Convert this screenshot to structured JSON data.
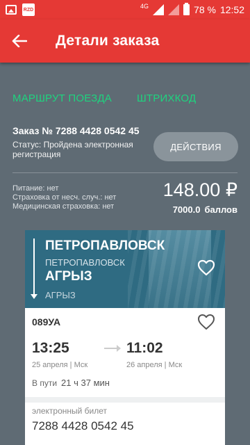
{
  "status_bar": {
    "network": "4G",
    "battery": "78 %",
    "time": "12:52",
    "app_icon_text": "RZD"
  },
  "toolbar": {
    "title": "Детали заказа"
  },
  "tabs": [
    {
      "label": "МАРШРУТ ПОЕЗДА"
    },
    {
      "label": "ШТРИХКОД"
    }
  ],
  "order": {
    "number": "Заказ № 7288 4428 0542 45",
    "status": "Статус: Пройдена электронная регистрация",
    "actions_label": "ДЕЙСТВИЯ",
    "extras": [
      "Питание: нет",
      "Страховка от несч. случ.: нет",
      "Медицинская страховка: нет"
    ],
    "price": "148.00 ₽",
    "points_value": "7000.0",
    "points_unit": "баллов"
  },
  "ticket": {
    "from_city": "ПЕТРОПАВЛОВСК",
    "from_station": "ПЕТРОПАВЛОВСК",
    "to_city": "АГРЫЗ",
    "to_station": "АГРЫЗ",
    "train": "089УА",
    "departure_time": "13:25",
    "arrival_time": "11:02",
    "departure_date": "25 апреля | Мск",
    "arrival_date": "26 апреля | Мск",
    "travel_label": "В пути",
    "travel_value": "21 ч 37 мин",
    "eticket_label": "электронный билет",
    "eticket_number": "7288 4428 0542 45"
  },
  "colors": {
    "accent": "#e53935",
    "tab_text": "#1ed47f",
    "background": "#5f6b74",
    "hero": "#2f6b82"
  },
  "icons": {
    "back": "arrow-left-icon",
    "favorite": "heart-outline-icon"
  }
}
